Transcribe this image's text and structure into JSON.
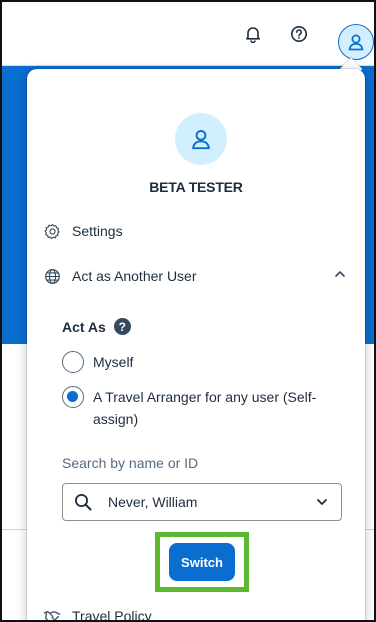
{
  "header": {
    "notifications_icon": "bell-icon",
    "help_icon": "help-circle-icon",
    "avatar_icon": "user-icon"
  },
  "profile_menu": {
    "avatar_icon": "user-icon",
    "user_name": "BETA TESTER",
    "items": [
      {
        "label": "Settings",
        "icon": "gear-icon"
      },
      {
        "label": "Act as Another User",
        "icon": "globe-icon",
        "expanded": true
      },
      {
        "label": "Travel Policy",
        "icon": "handshake-icon"
      }
    ],
    "act_as": {
      "title": "Act As",
      "help_icon": "help-icon",
      "options": [
        {
          "label": "Myself",
          "selected": false
        },
        {
          "label": "A Travel Arranger for any user (Self-assign)",
          "selected": true
        }
      ],
      "search_label": "Search by name or ID",
      "search_value": "Never, William",
      "switch_label": "Switch"
    }
  },
  "colors": {
    "accent": "#0a6ed1",
    "highlight": "#5cb82e",
    "avatar_bg": "#d1efff",
    "text": "#1d2d3e"
  }
}
